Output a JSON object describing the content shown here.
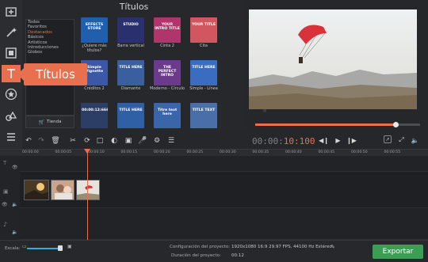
{
  "panel": {
    "title": "Títulos"
  },
  "callout": {
    "label": "Títulos"
  },
  "categories": [
    "Todos",
    "Favoritos",
    "Destacados",
    "Básicos",
    "Artísticos",
    "Introducciones",
    "Globos"
  ],
  "selected_category": "Destacados",
  "store_button": "Tienda",
  "tiles": [
    {
      "text": "EFFECTS STORE",
      "label": "¿Quiere más títulos?",
      "bg": "#1f5fae"
    },
    {
      "text": "STUDIO",
      "label": "Barra vertical",
      "bg": "#2a2f6e"
    },
    {
      "text": "YOUR INTRO TITLE",
      "label": "Cinta 2",
      "bg": "#b0356a"
    },
    {
      "text": "YOUR TITLE",
      "label": "Cita",
      "bg": "#d2565f"
    },
    {
      "text": "Simple Vignette",
      "label": "Créditos 2",
      "bg": "#3d57a7"
    },
    {
      "text": "TITLE HERE",
      "label": "Diamante",
      "bg": "#3a5f9e"
    },
    {
      "text": "THE PERFECT INTRO",
      "label": "Moderno - Círculo",
      "bg": "#6c3a8c"
    },
    {
      "text": "TITLE HERE",
      "label": "Simple - Línea",
      "bg": "#3a6dbf"
    },
    {
      "text": "00:00:12:666",
      "label": "",
      "bg": "#2c3d66"
    },
    {
      "text": "TITLE HERE",
      "label": "",
      "bg": "#2f5fa5"
    },
    {
      "text": "Titre text here",
      "label": "",
      "bg": "#3a65a8"
    },
    {
      "text": "TITLE TEXT",
      "label": "",
      "bg": "#4a6fa8"
    }
  ],
  "player": {
    "timecode_dim": "00:00:",
    "timecode_active": "10:100",
    "progress": 0.85
  },
  "ruler_ticks": [
    "00:00:00",
    "00:00:05",
    "00:00:10",
    "00:00:15",
    "00:00:20",
    "00:00:25",
    "00:00:30",
    "00:00:35",
    "00:00:40",
    "00:00:45",
    "00:00:50",
    "00:00:55"
  ],
  "bottom": {
    "scale_label": "Escala:",
    "config_label": "Configuración del proyecto:",
    "config_value": "1920x1080 16:9 29.97 FPS, 44100 Hz Estéreo",
    "duration_label": "Duración del proyecto:",
    "duration_value": "00:12",
    "zoom_level": 0.93
  },
  "export_button": "Exportar",
  "colors": {
    "accent": "#e8704f",
    "export": "#3b9e55",
    "zoom": "#3fa5e0"
  }
}
